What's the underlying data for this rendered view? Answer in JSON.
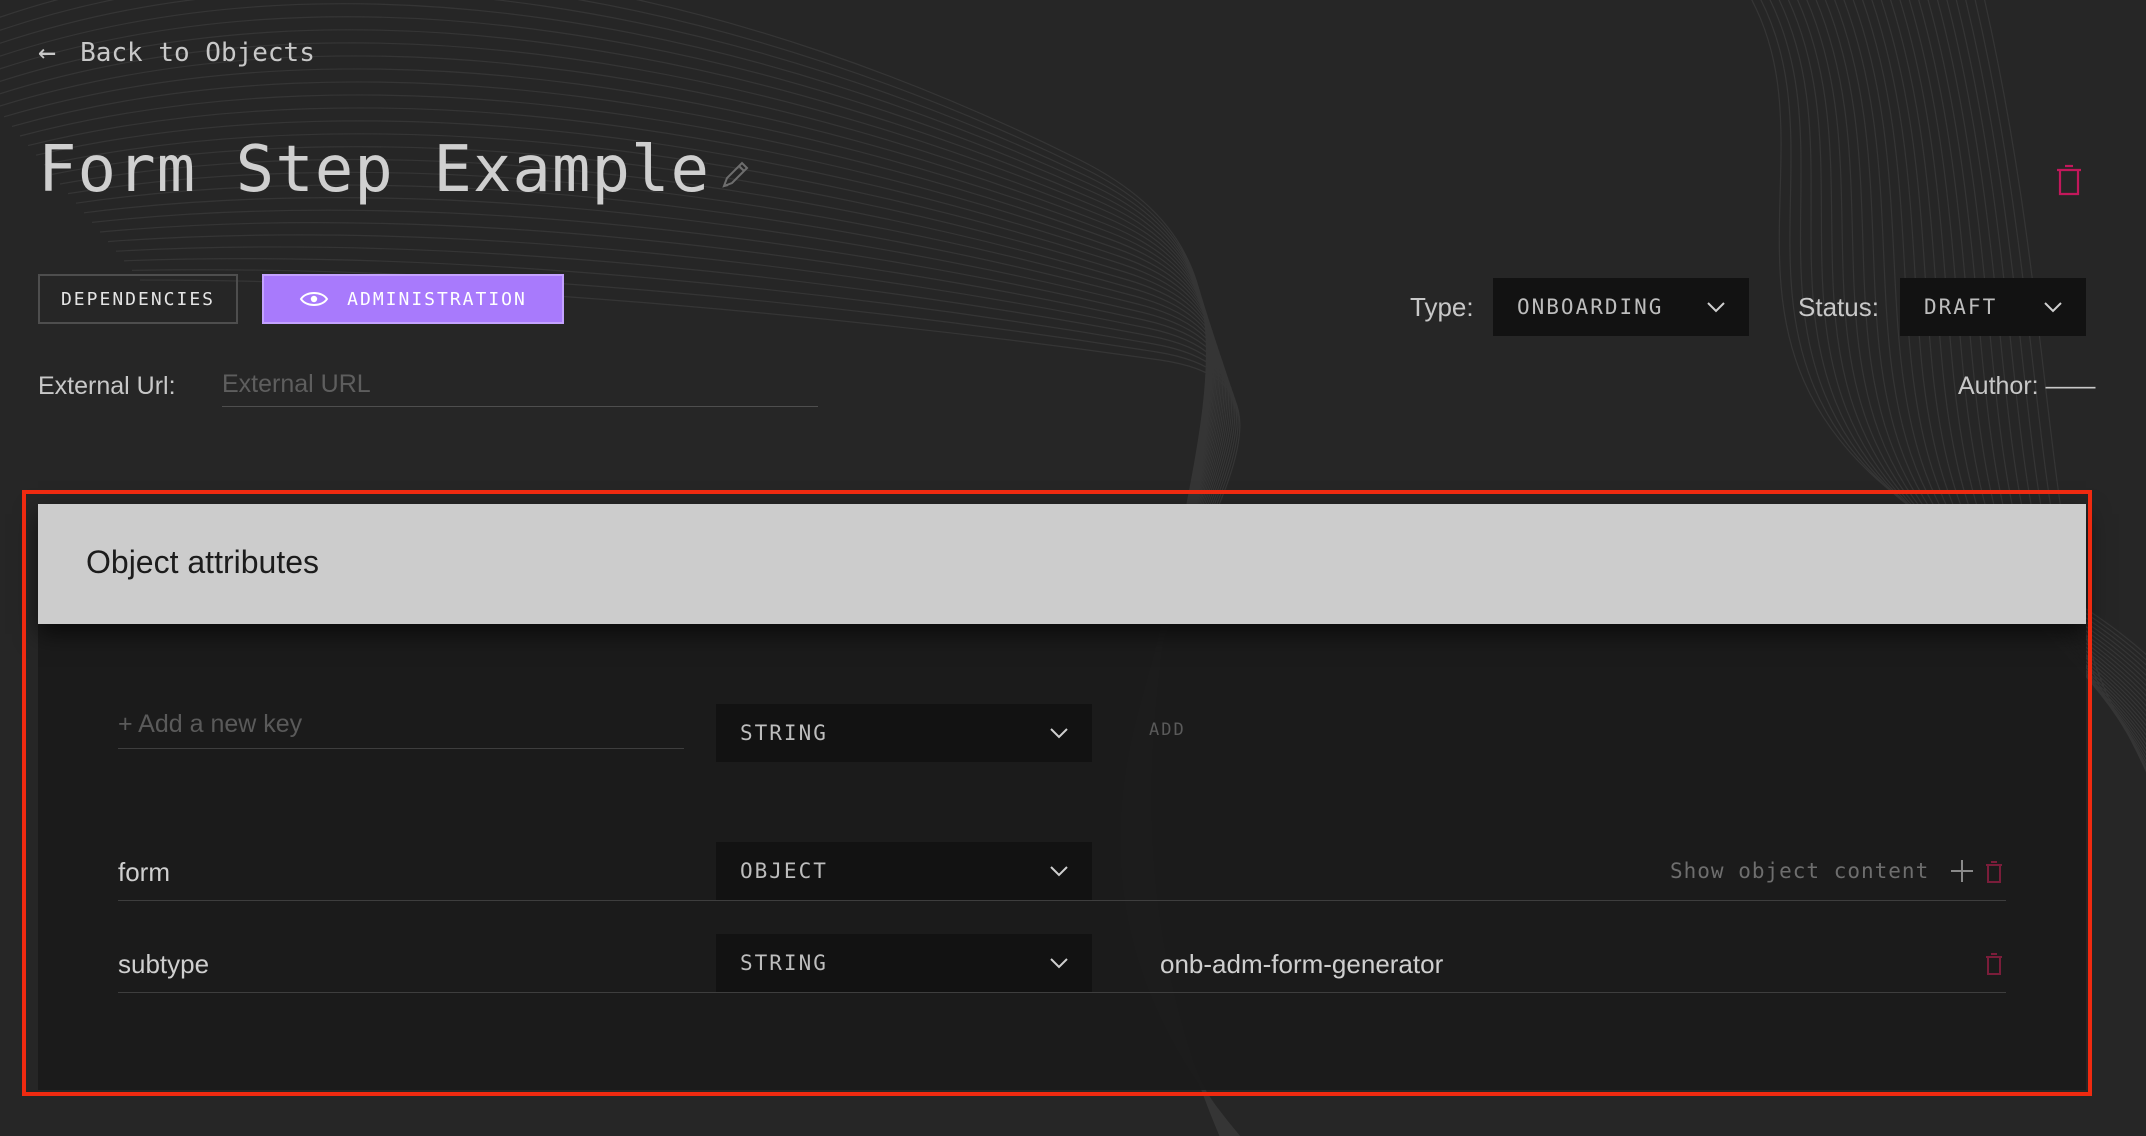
{
  "nav": {
    "back_label": "Back to Objects"
  },
  "object": {
    "title": "Form Step Example",
    "tabs": {
      "dependencies": "DEPENDENCIES",
      "administration": "ADMINISTRATION"
    },
    "type_label": "Type:",
    "type_value": "ONBOARDING",
    "status_label": "Status:",
    "status_value": "DRAFT",
    "external_url_label": "External Url:",
    "external_url_placeholder": "External URL",
    "author": "Author: ——"
  },
  "attributes": {
    "title": "Object attributes",
    "new_key_placeholder": "+ Add a new key",
    "new_key_type": "STRING",
    "add_label": "ADD",
    "rows": [
      {
        "key": "form",
        "type": "OBJECT",
        "action": "Show object content"
      },
      {
        "key": "subtype",
        "type": "STRING",
        "value": "onb-adm-form-generator"
      }
    ]
  },
  "colors": {
    "accent": "#a87afc",
    "danger": "#c2185b",
    "highlight": "#ef2a10",
    "background": "#262626",
    "panel_header": "#cccccc"
  },
  "icons": {
    "back": "arrow-left-icon",
    "edit": "pencil-icon",
    "delete": "trash-icon",
    "admin": "eye-icon",
    "dropdown": "chevron-down-icon",
    "expand": "plus-icon"
  }
}
